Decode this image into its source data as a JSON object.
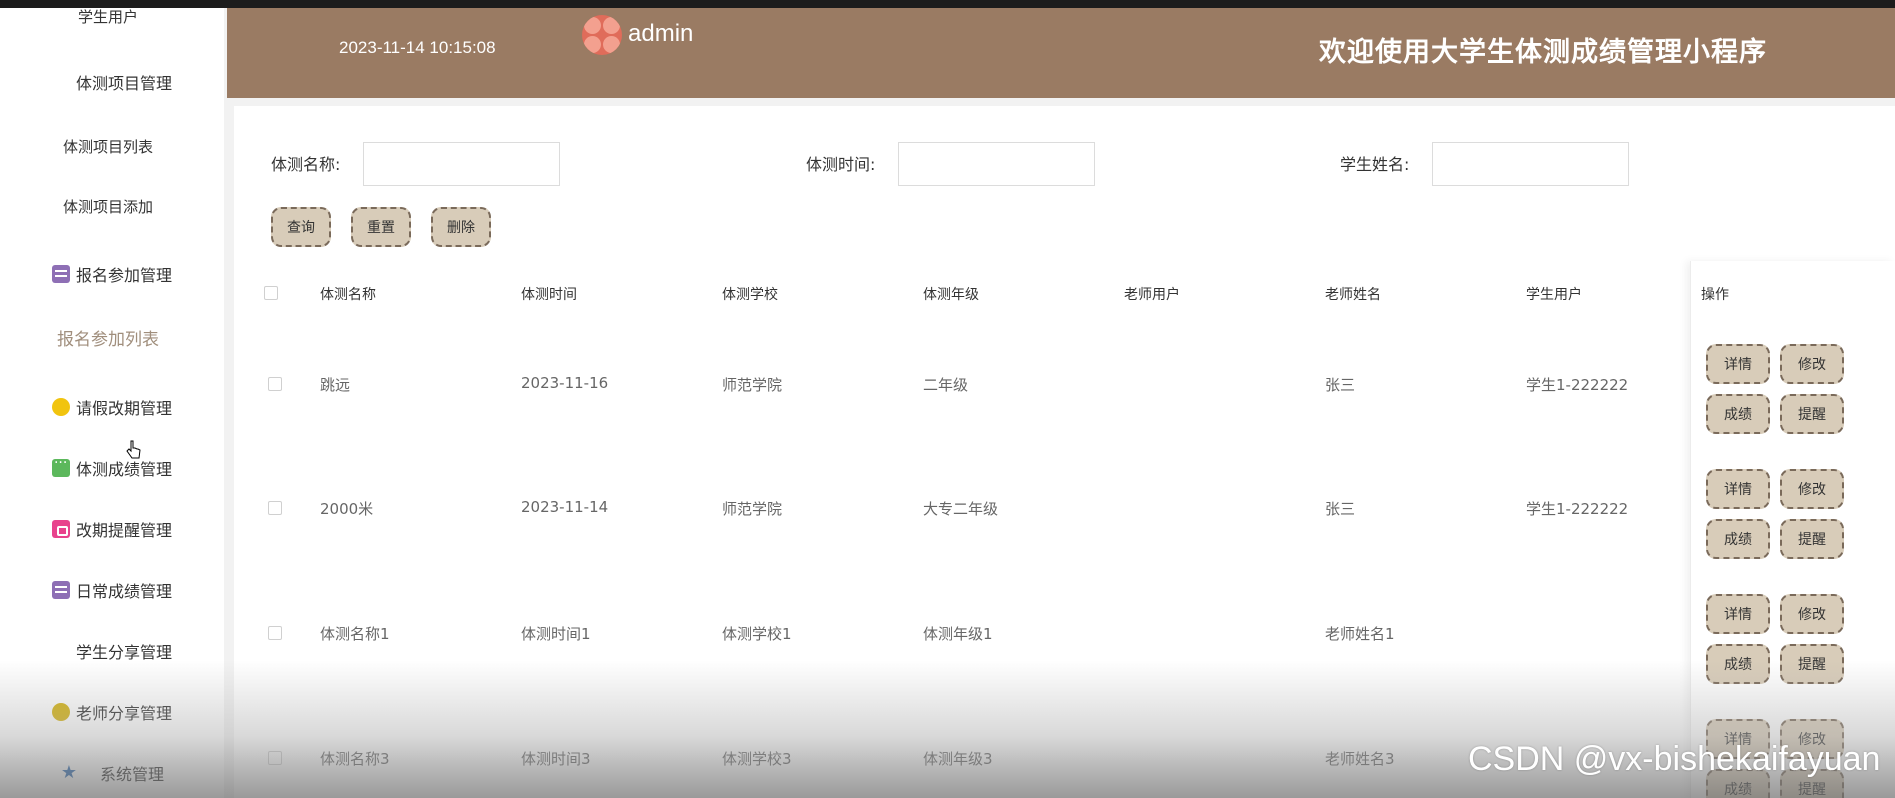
{
  "header": {
    "datetime": "2023-11-14 10:15:08",
    "username": "admin",
    "title": "欢迎使用大学生体测成绩管理小程序"
  },
  "sidebar": {
    "partial_item": "学生用户",
    "items": [
      {
        "label": "体测项目管理",
        "icon": "grid-icon",
        "color": "#f0694a"
      },
      {
        "label": "体测项目列表",
        "sub": true
      },
      {
        "label": "体测项目添加",
        "sub": true
      },
      {
        "label": "报名参加管理",
        "icon": "box-icon",
        "color": "#8e6fb5"
      },
      {
        "label": "报名参加列表",
        "sub": true,
        "active": true
      },
      {
        "label": "请假改期管理",
        "icon": "hex-icon",
        "color": "#f1c40f"
      },
      {
        "label": "体测成绩管理",
        "icon": "chat-icon",
        "color": "#5cb85c"
      },
      {
        "label": "改期提醒管理",
        "icon": "calendar-icon",
        "color": "#e8438d"
      },
      {
        "label": "日常成绩管理",
        "icon": "box-icon",
        "color": "#8e6fb5"
      },
      {
        "label": "学生分享管理",
        "icon": "grid-icon",
        "color": "#f0694a"
      },
      {
        "label": "老师分享管理",
        "icon": "hex-icon",
        "color": "#d4b20f"
      },
      {
        "label": "系统管理",
        "icon": "star-icon",
        "color": "#2f6db5"
      }
    ]
  },
  "search": {
    "name_label": "体测名称:",
    "time_label": "体测时间:",
    "student_label": "学生姓名:",
    "name_value": "",
    "time_value": "",
    "student_value": ""
  },
  "actions": {
    "query": "查询",
    "reset": "重置",
    "delete": "删除"
  },
  "table": {
    "headers": [
      "体测名称",
      "体测时间",
      "体测学校",
      "体测年级",
      "老师用户",
      "老师姓名",
      "学生用户",
      "操作"
    ],
    "rows": [
      [
        "跳远",
        "2023-11-16",
        "师范学院",
        "二年级",
        "",
        "张三",
        "学生1-222222"
      ],
      [
        "2000米",
        "2023-11-14",
        "师范学院",
        "大专二年级",
        "",
        "张三",
        "学生1-222222"
      ],
      [
        "体测名称1",
        "体测时间1",
        "体测学校1",
        "体测年级1",
        "",
        "老师姓名1",
        ""
      ],
      [
        "体测名称3",
        "体测时间3",
        "体测学校3",
        "体测年级3",
        "",
        "老师姓名3",
        ""
      ]
    ],
    "row_actions": [
      "详情",
      "修改",
      "成绩",
      "提醒"
    ]
  },
  "watermark": "CSDN @vx-bishekaifayuan",
  "colors": {
    "header_bg": "#9a7b63",
    "button_bg": "#d8ccb9",
    "button_border": "#7a6a5a",
    "active_menu": "#a08e7c"
  }
}
